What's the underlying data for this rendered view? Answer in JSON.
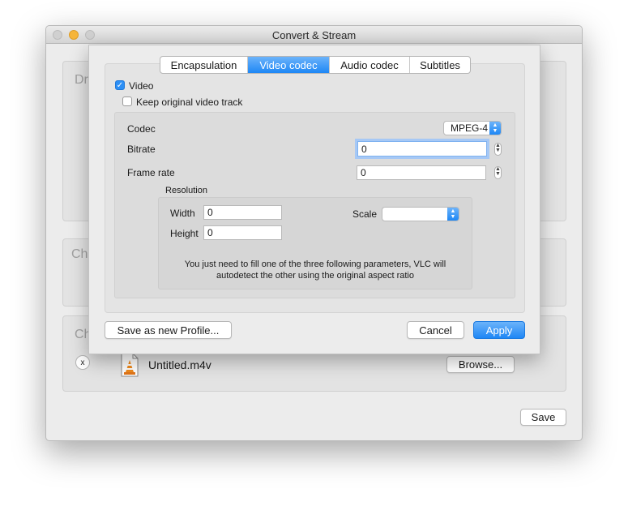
{
  "window": {
    "title": "Convert & Stream",
    "traffic_colors": {
      "close": "#d0d0d0",
      "minimize": "#f6b53a",
      "zoom": "#d0d0d0"
    },
    "bg_labels": [
      "Dr",
      "Ch",
      "Ch"
    ],
    "file": {
      "name": "Untitled.m4v",
      "remove_label": "x",
      "browse_label": "Browse..."
    },
    "save_label": "Save"
  },
  "sheet": {
    "tabs": [
      {
        "label": "Encapsulation",
        "active": false
      },
      {
        "label": "Video codec",
        "active": true
      },
      {
        "label": "Audio codec",
        "active": false
      },
      {
        "label": "Subtitles",
        "active": false
      }
    ],
    "video_checkbox": {
      "label": "Video",
      "checked": true
    },
    "keep_original": {
      "label": "Keep original video track",
      "checked": false
    },
    "codec": {
      "label": "Codec",
      "value": "MPEG-4"
    },
    "bitrate": {
      "label": "Bitrate",
      "value": "0"
    },
    "frame_rate": {
      "label": "Frame rate",
      "value": "0"
    },
    "resolution": {
      "title": "Resolution",
      "width": {
        "label": "Width",
        "value": "0"
      },
      "height": {
        "label": "Height",
        "value": "0"
      },
      "scale": {
        "label": "Scale",
        "value": ""
      },
      "hint": "You just need to fill one of the three following parameters, VLC will autodetect the other using the original aspect ratio"
    },
    "buttons": {
      "save_profile": "Save as new Profile...",
      "cancel": "Cancel",
      "apply": "Apply"
    },
    "accent_color": "#1e87f5"
  }
}
